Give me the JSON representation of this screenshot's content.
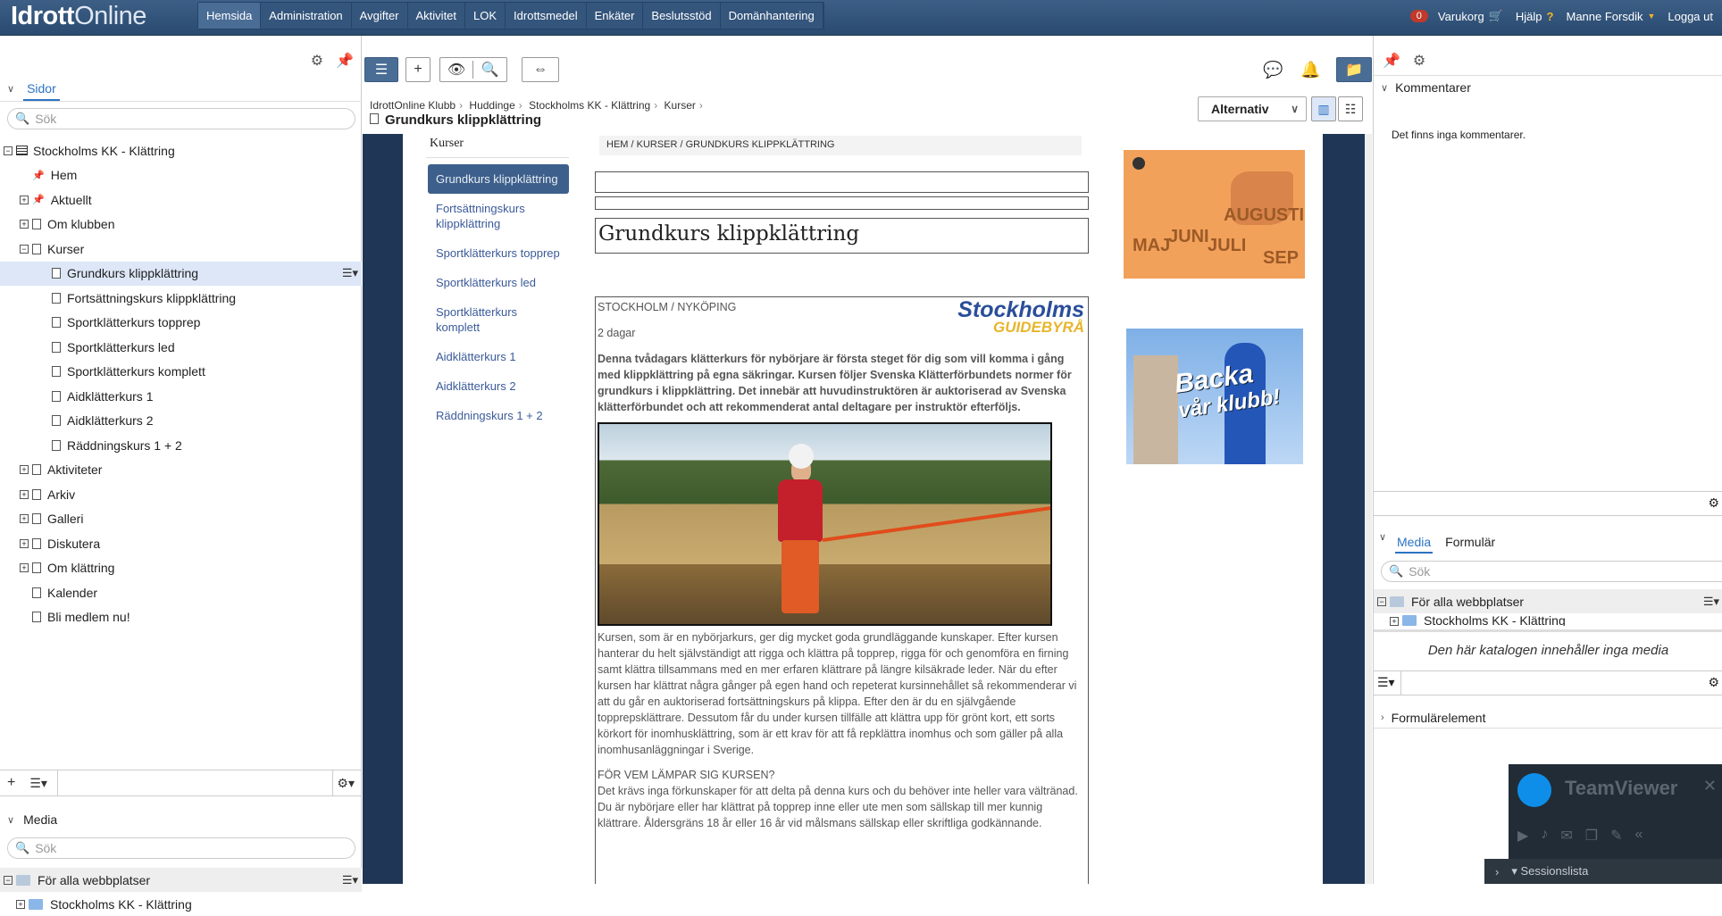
{
  "app": {
    "logo_main": "Idrott",
    "logo_tail": "Online",
    "nav": [
      "Hemsida",
      "Administration",
      "Avgifter",
      "Aktivitet",
      "LOK",
      "Idrottsmedel",
      "Enkäter",
      "Beslutsstöd",
      "Domänhantering"
    ],
    "cart_count": "0",
    "cart_label": "Varukorg",
    "help_label": "Hjälp",
    "user_name": "Manne Forsdik",
    "logout_label": "Logga ut"
  },
  "left": {
    "tab_label": "Sidor",
    "search_placeholder": "Sök",
    "tree": [
      {
        "label": "Stockholms KK - Klättring",
        "level": 0,
        "expander": "−",
        "icon": "list"
      },
      {
        "label": "Hem",
        "level": 1,
        "expander": "",
        "icon": "pin"
      },
      {
        "label": "Aktuellt",
        "level": 1,
        "expander": "+",
        "icon": "pin"
      },
      {
        "label": "Om klubben",
        "level": 1,
        "expander": "+",
        "icon": "page"
      },
      {
        "label": "Kurser",
        "level": 1,
        "expander": "−",
        "icon": "page"
      },
      {
        "label": "Grundkurs klippklättring",
        "level": 2,
        "expander": "",
        "icon": "page",
        "selected": true
      },
      {
        "label": "Fortsättningskurs klippklättring",
        "level": 2,
        "expander": "",
        "icon": "page"
      },
      {
        "label": "Sportklätterkurs topprep",
        "level": 2,
        "expander": "",
        "icon": "page"
      },
      {
        "label": "Sportklätterkurs led",
        "level": 2,
        "expander": "",
        "icon": "page"
      },
      {
        "label": "Sportklätterkurs komplett",
        "level": 2,
        "expander": "",
        "icon": "page"
      },
      {
        "label": "Aidklätterkurs 1",
        "level": 2,
        "expander": "",
        "icon": "page"
      },
      {
        "label": "Aidklätterkurs 2",
        "level": 2,
        "expander": "",
        "icon": "page"
      },
      {
        "label": "Räddningskurs 1 + 2",
        "level": 2,
        "expander": "",
        "icon": "page"
      },
      {
        "label": "Aktiviteter",
        "level": 1,
        "expander": "+",
        "icon": "page"
      },
      {
        "label": "Arkiv",
        "level": 1,
        "expander": "+",
        "icon": "page"
      },
      {
        "label": "Galleri",
        "level": 1,
        "expander": "+",
        "icon": "page"
      },
      {
        "label": "Diskutera",
        "level": 1,
        "expander": "+",
        "icon": "page"
      },
      {
        "label": "Om klättring",
        "level": 1,
        "expander": "+",
        "icon": "page"
      },
      {
        "label": "Kalender",
        "level": 1,
        "expander": "",
        "icon": "page"
      },
      {
        "label": "Bli medlem nu!",
        "level": 1,
        "expander": "",
        "icon": "page"
      }
    ],
    "media_label": "Media",
    "media_search_placeholder": "Sök",
    "media_rows": [
      "För alla webbplatser",
      "Stockholms KK - Klättring"
    ]
  },
  "center": {
    "breadcrumb": [
      "IdrottOnline Klubb",
      "Huddinge",
      "Stockholms KK - Klättring",
      "Kurser"
    ],
    "page_title": "Grundkurs klippklättring",
    "alternativ_label": "Alternativ",
    "site": {
      "subnav_title": "Kurser",
      "subnav": [
        "Grundkurs klippklättring",
        "Fortsättningskurs klippklättring",
        "Sportklätterkurs topprep",
        "Sportklätterkurs led",
        "Sportklätterkurs komplett",
        "Aidklätterkurs 1",
        "Aidklätterkurs 2",
        "Räddningskurs 1 + 2"
      ],
      "crumbs": "HEM / KURSER / GRUNDKURS KLIPPKLÄTTRING",
      "course_title": "Grundkurs klippklättring",
      "location": "STOCKHOLM / NYKÖPING",
      "duration": "2 dagar",
      "logo_line1": "Stockholms",
      "logo_line2": "GUIDEBYRÅ",
      "intro": "Denna tvådagars klätterkurs för nybörjare är första steget för dig som vill komma i gång med klippklättring på egna säkringar. Kursen följer Svenska Klätterförbundets normer för grundkurs i klippklättring. Det innebär att huvudinstruktören är auktoriserad av Svenska klätterförbundet och att rekommenderat antal deltagare per instruktör efterföljs.",
      "body": "Kursen, som är en nybörjarkurs, ger dig mycket goda grundläggande kunskaper. Efter kursen hanterar du helt självständigt att rigga och klättra på topprep, rigga för och genomföra en firning samt klättra tillsammans med en mer erfaren klättrare på längre kilsäkrade leder. När du efter kursen har klättrat några gånger på egen hand och repeterat kursinnehållet så rekommenderar vi att du går en auktoriserad fortsättningskurs på klippa. Efter den är du en självgående topprepsklättrare. Dessutom får du under kursen tillfälle att klättra upp för grönt kort, ett sorts körkort för inomhusklättring, som är ett krav för att få repklättra inomhus och som gäller på alla inomhusanläggningar i Sverige.",
      "for_whom_heading": "FÖR VEM LÄMPAR SIG KURSEN?",
      "for_whom": "Det krävs inga förkunskaper för att delta på denna kurs och du behöver inte heller vara vältränad. Du är nybörjare eller har klättrat på topprep inne eller ute men som sällskap till mer kunnig klättrare. Åldersgräns 18 år eller 16 år vid målsmans sällskap eller skriftliga godkännande.",
      "ad1_months": [
        "MAJ",
        "JUNI",
        "JULI",
        "AUGUSTI",
        "SEP"
      ],
      "ad2_text1": "Backa",
      "ad2_text2": "vår klubb!"
    }
  },
  "right": {
    "comments_label": "Kommentarer",
    "no_comments": "Det finns inga kommentarer.",
    "tab_media": "Media",
    "tab_form": "Formulär",
    "search_placeholder": "Sök",
    "media_rows": [
      "För alla webbplatser",
      "Stockholms KK - Klättring"
    ],
    "empty_media": "Den här katalogen innehåller inga media",
    "form_elements_label": "Formulärelement",
    "teamviewer_title": "TeamViewer",
    "session_list": "Sessionslista"
  }
}
